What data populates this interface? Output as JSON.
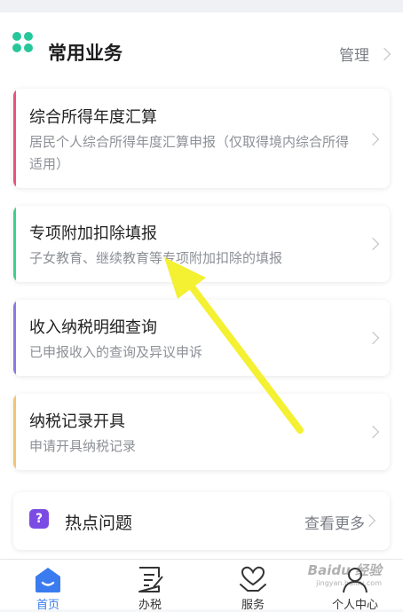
{
  "section": {
    "title": "常用业务",
    "manage_label": "管理"
  },
  "cards": [
    {
      "title": "综合所得年度汇算",
      "desc": "居民个人综合所得年度汇算申报（仅取得境内综合所得适用）",
      "color": "#e9537a"
    },
    {
      "title": "专项附加扣除填报",
      "desc": "子女教育、继续教育等专项附加扣除的填报",
      "color": "#3fcf8e"
    },
    {
      "title": "收入纳税明细查询",
      "desc": "已申报收入的查询及异议申诉",
      "color": "#8b78e6"
    },
    {
      "title": "纳税记录开具",
      "desc": "申请开具纳税记录",
      "color": "#f3c372"
    }
  ],
  "hot": {
    "icon": "question-chat-icon",
    "title": "热点问题",
    "more_label": "查看更多"
  },
  "tabs": [
    {
      "label": "首页",
      "icon": "home-icon",
      "active": true
    },
    {
      "label": "办税",
      "icon": "document-edit-icon",
      "active": false
    },
    {
      "label": "服务",
      "icon": "heart-hands-icon",
      "active": false
    },
    {
      "label": "个人中心",
      "icon": "person-icon",
      "active": false
    }
  ],
  "watermark": {
    "text": "Baidu 经验",
    "sub": "jingyan.baidu.com"
  },
  "colors": {
    "accent": "#3a7cf0",
    "brand_green": "#26c79a",
    "arrow": "#f4f032"
  }
}
